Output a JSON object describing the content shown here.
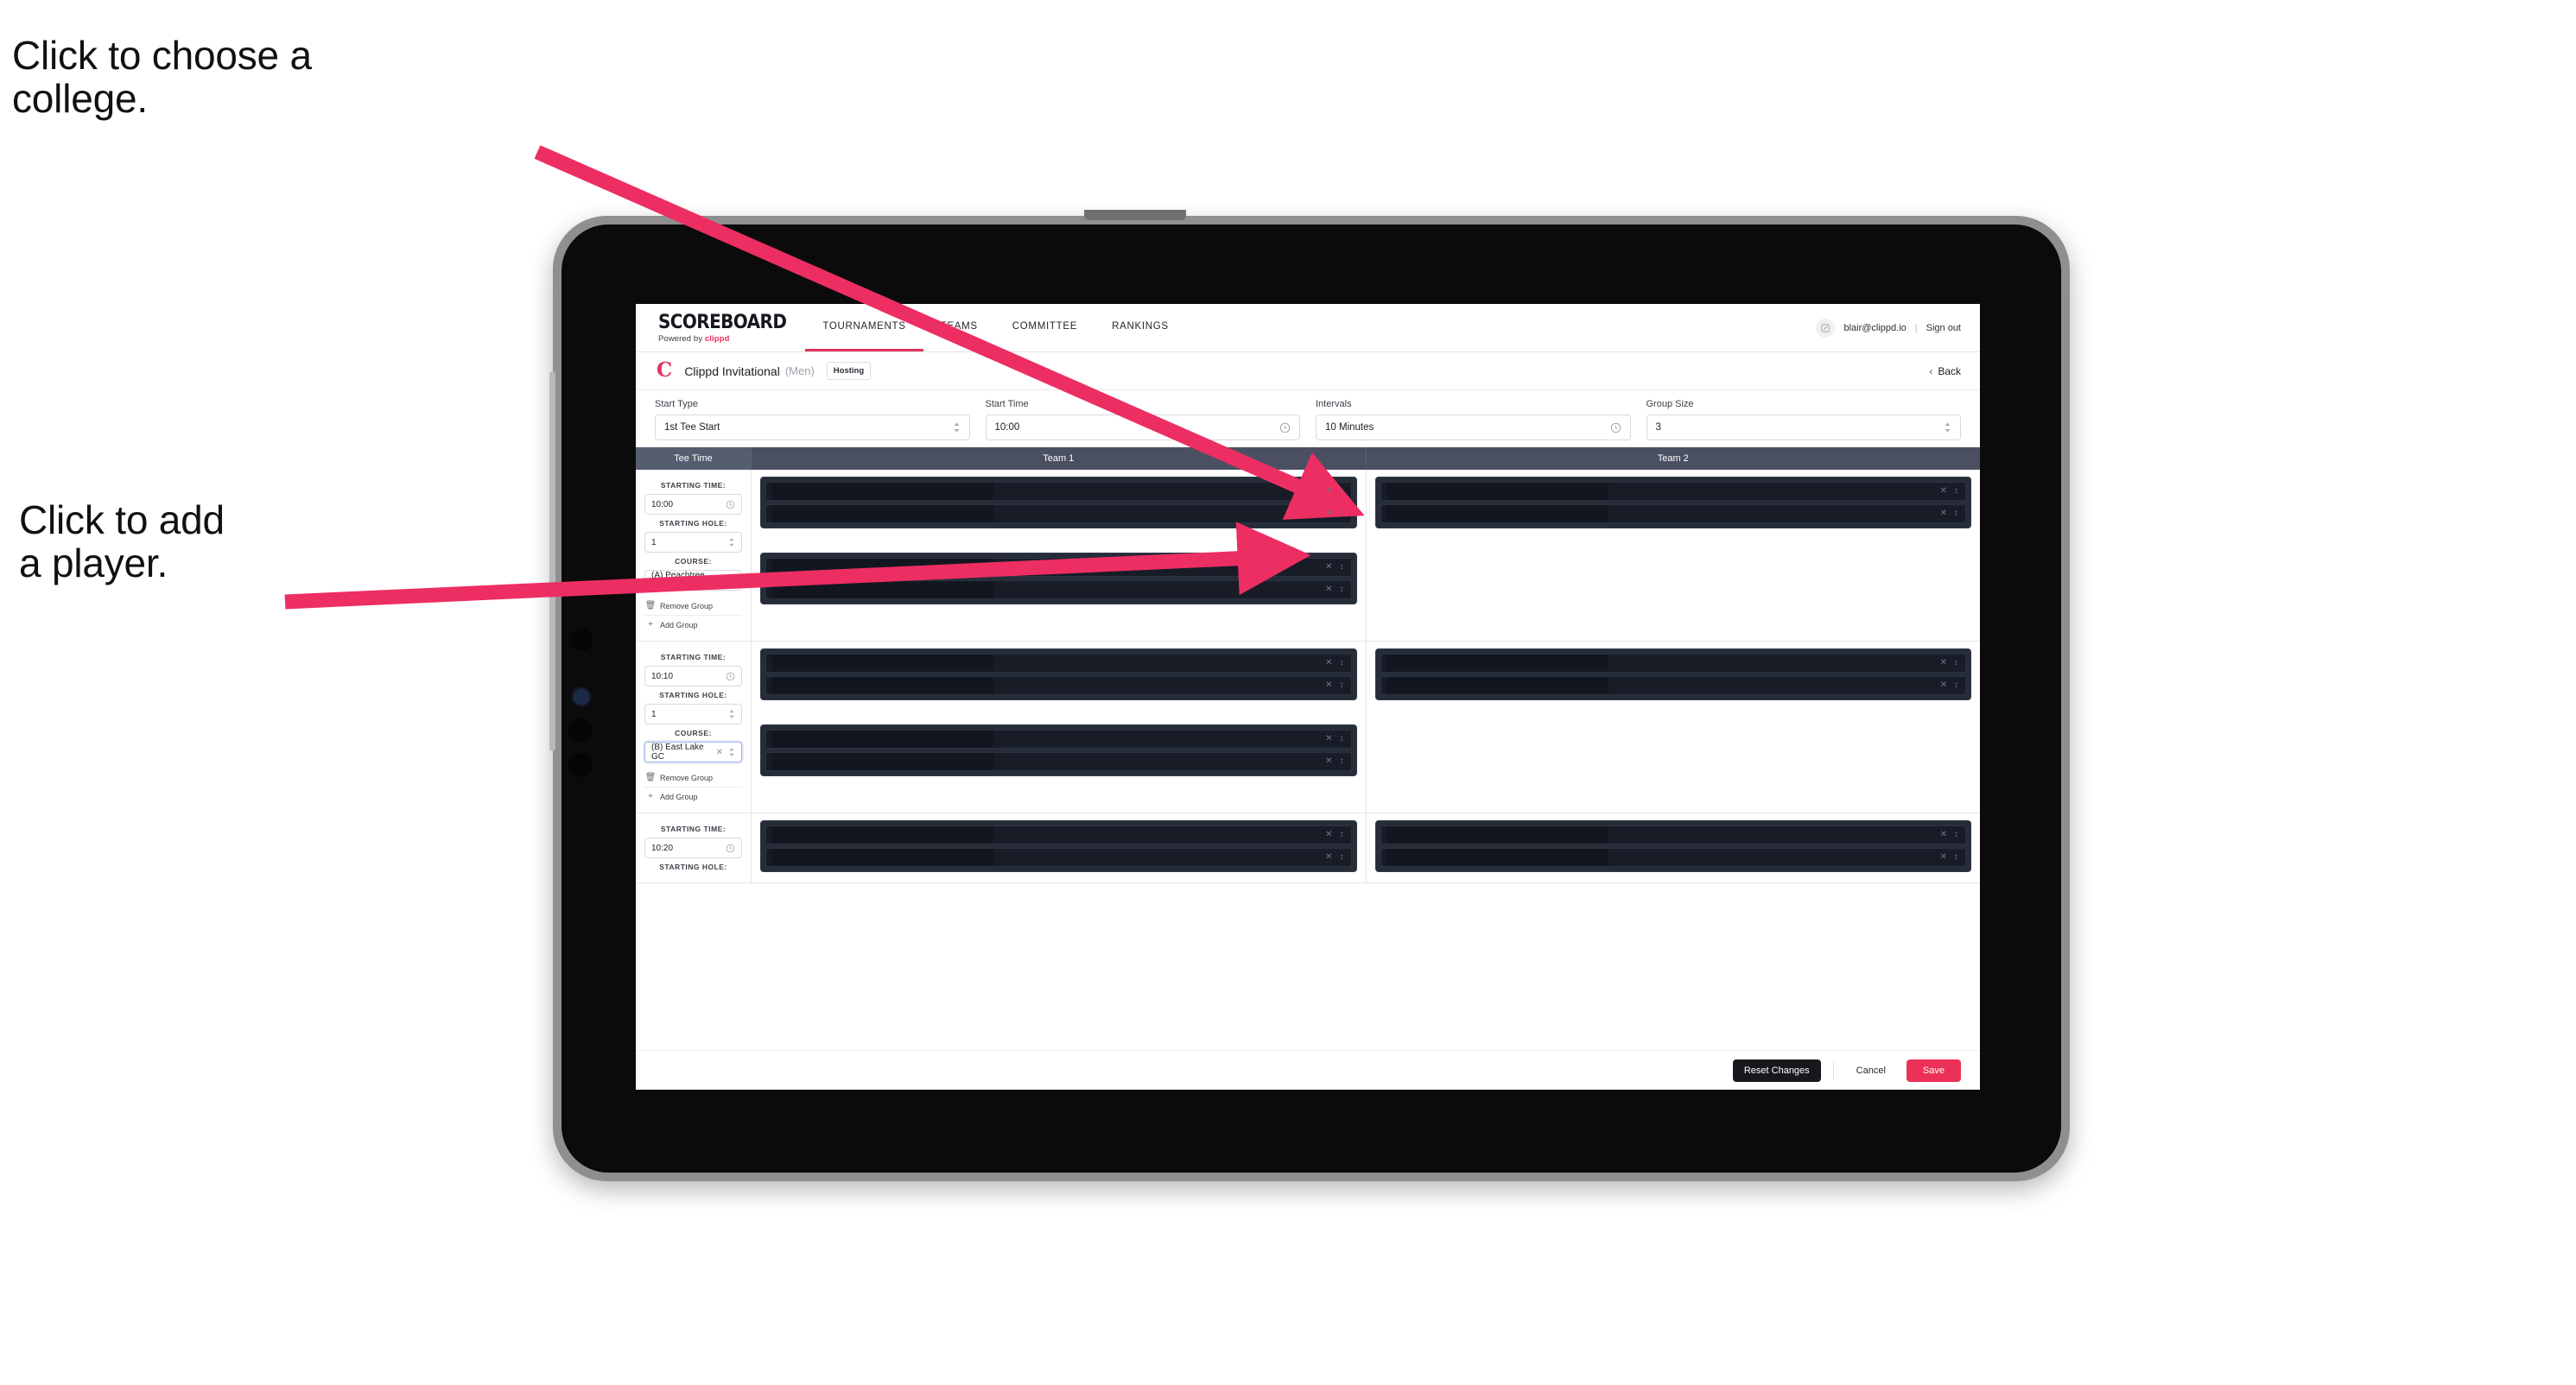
{
  "annotations": [
    {
      "id": "choose-college",
      "text": "Click to choose a\ncollege."
    },
    {
      "id": "add-player",
      "text": "Click to add\na player."
    }
  ],
  "colors": {
    "accent_pink": "#ec3158",
    "arrow_pink": "#ed2e63",
    "table_header": "#4a5061",
    "dark_row": "#171c27",
    "dark_group": "#262c38"
  },
  "navbar": {
    "brand_title": "SCOREBOARD",
    "brand_sub_prefix": "Powered by ",
    "brand_sub_brand": "clippd",
    "links": [
      {
        "label": "TOURNAMENTS",
        "active": true
      },
      {
        "label": "TEAMS",
        "active": false
      },
      {
        "label": "COMMITTEE",
        "active": false
      },
      {
        "label": "RANKINGS",
        "active": false
      }
    ],
    "avatar_icon": "user-icon",
    "email": "blair@clippd.io",
    "separator": "|",
    "sign_out": "Sign out"
  },
  "tournament_bar": {
    "logo_letter": "C",
    "name": "Clippd Invitational",
    "gender": "(Men)",
    "badge": "Hosting",
    "back_label": "Back"
  },
  "controls": [
    {
      "label": "Start Type",
      "value": "1st Tee Start",
      "icon": "stepper-icon"
    },
    {
      "label": "Start Time",
      "value": "10:00",
      "icon": "clock-icon"
    },
    {
      "label": "Intervals",
      "value": "10 Minutes",
      "icon": "clock-icon"
    },
    {
      "label": "Group Size",
      "value": "3",
      "icon": "stepper-icon"
    }
  ],
  "table": {
    "headers": {
      "tee_time": "Tee Time",
      "team1": "Team 1",
      "team2": "Team 2"
    },
    "field_labels": {
      "starting_time": "STARTING TIME:",
      "starting_hole": "STARTING HOLE:",
      "course": "COURSE:"
    },
    "group_actions": {
      "remove": "Remove Group",
      "add": "Add Group"
    },
    "rows": [
      {
        "starting_time": "10:00",
        "starting_hole": "1",
        "course": "(A) Peachtree GC",
        "course_focused": false,
        "team1_groups": [
          {
            "players": [
              "",
              ""
            ]
          },
          {
            "players": [
              "",
              ""
            ]
          }
        ],
        "team2_groups": [
          {
            "players": [
              "",
              ""
            ]
          }
        ]
      },
      {
        "starting_time": "10:10",
        "starting_hole": "1",
        "course": "(B) East Lake GC",
        "course_focused": true,
        "team1_groups": [
          {
            "players": [
              "",
              ""
            ]
          },
          {
            "players": [
              "",
              ""
            ]
          }
        ],
        "team2_groups": [
          {
            "players": [
              "",
              ""
            ]
          }
        ]
      },
      {
        "starting_time": "10:20",
        "starting_hole": "",
        "course": "",
        "course_focused": false,
        "team1_groups": [
          {
            "players": [
              "",
              ""
            ]
          }
        ],
        "team2_groups": [
          {
            "players": [
              "",
              ""
            ]
          }
        ]
      }
    ]
  },
  "footer": {
    "reset": "Reset Changes",
    "cancel": "Cancel",
    "save": "Save"
  }
}
